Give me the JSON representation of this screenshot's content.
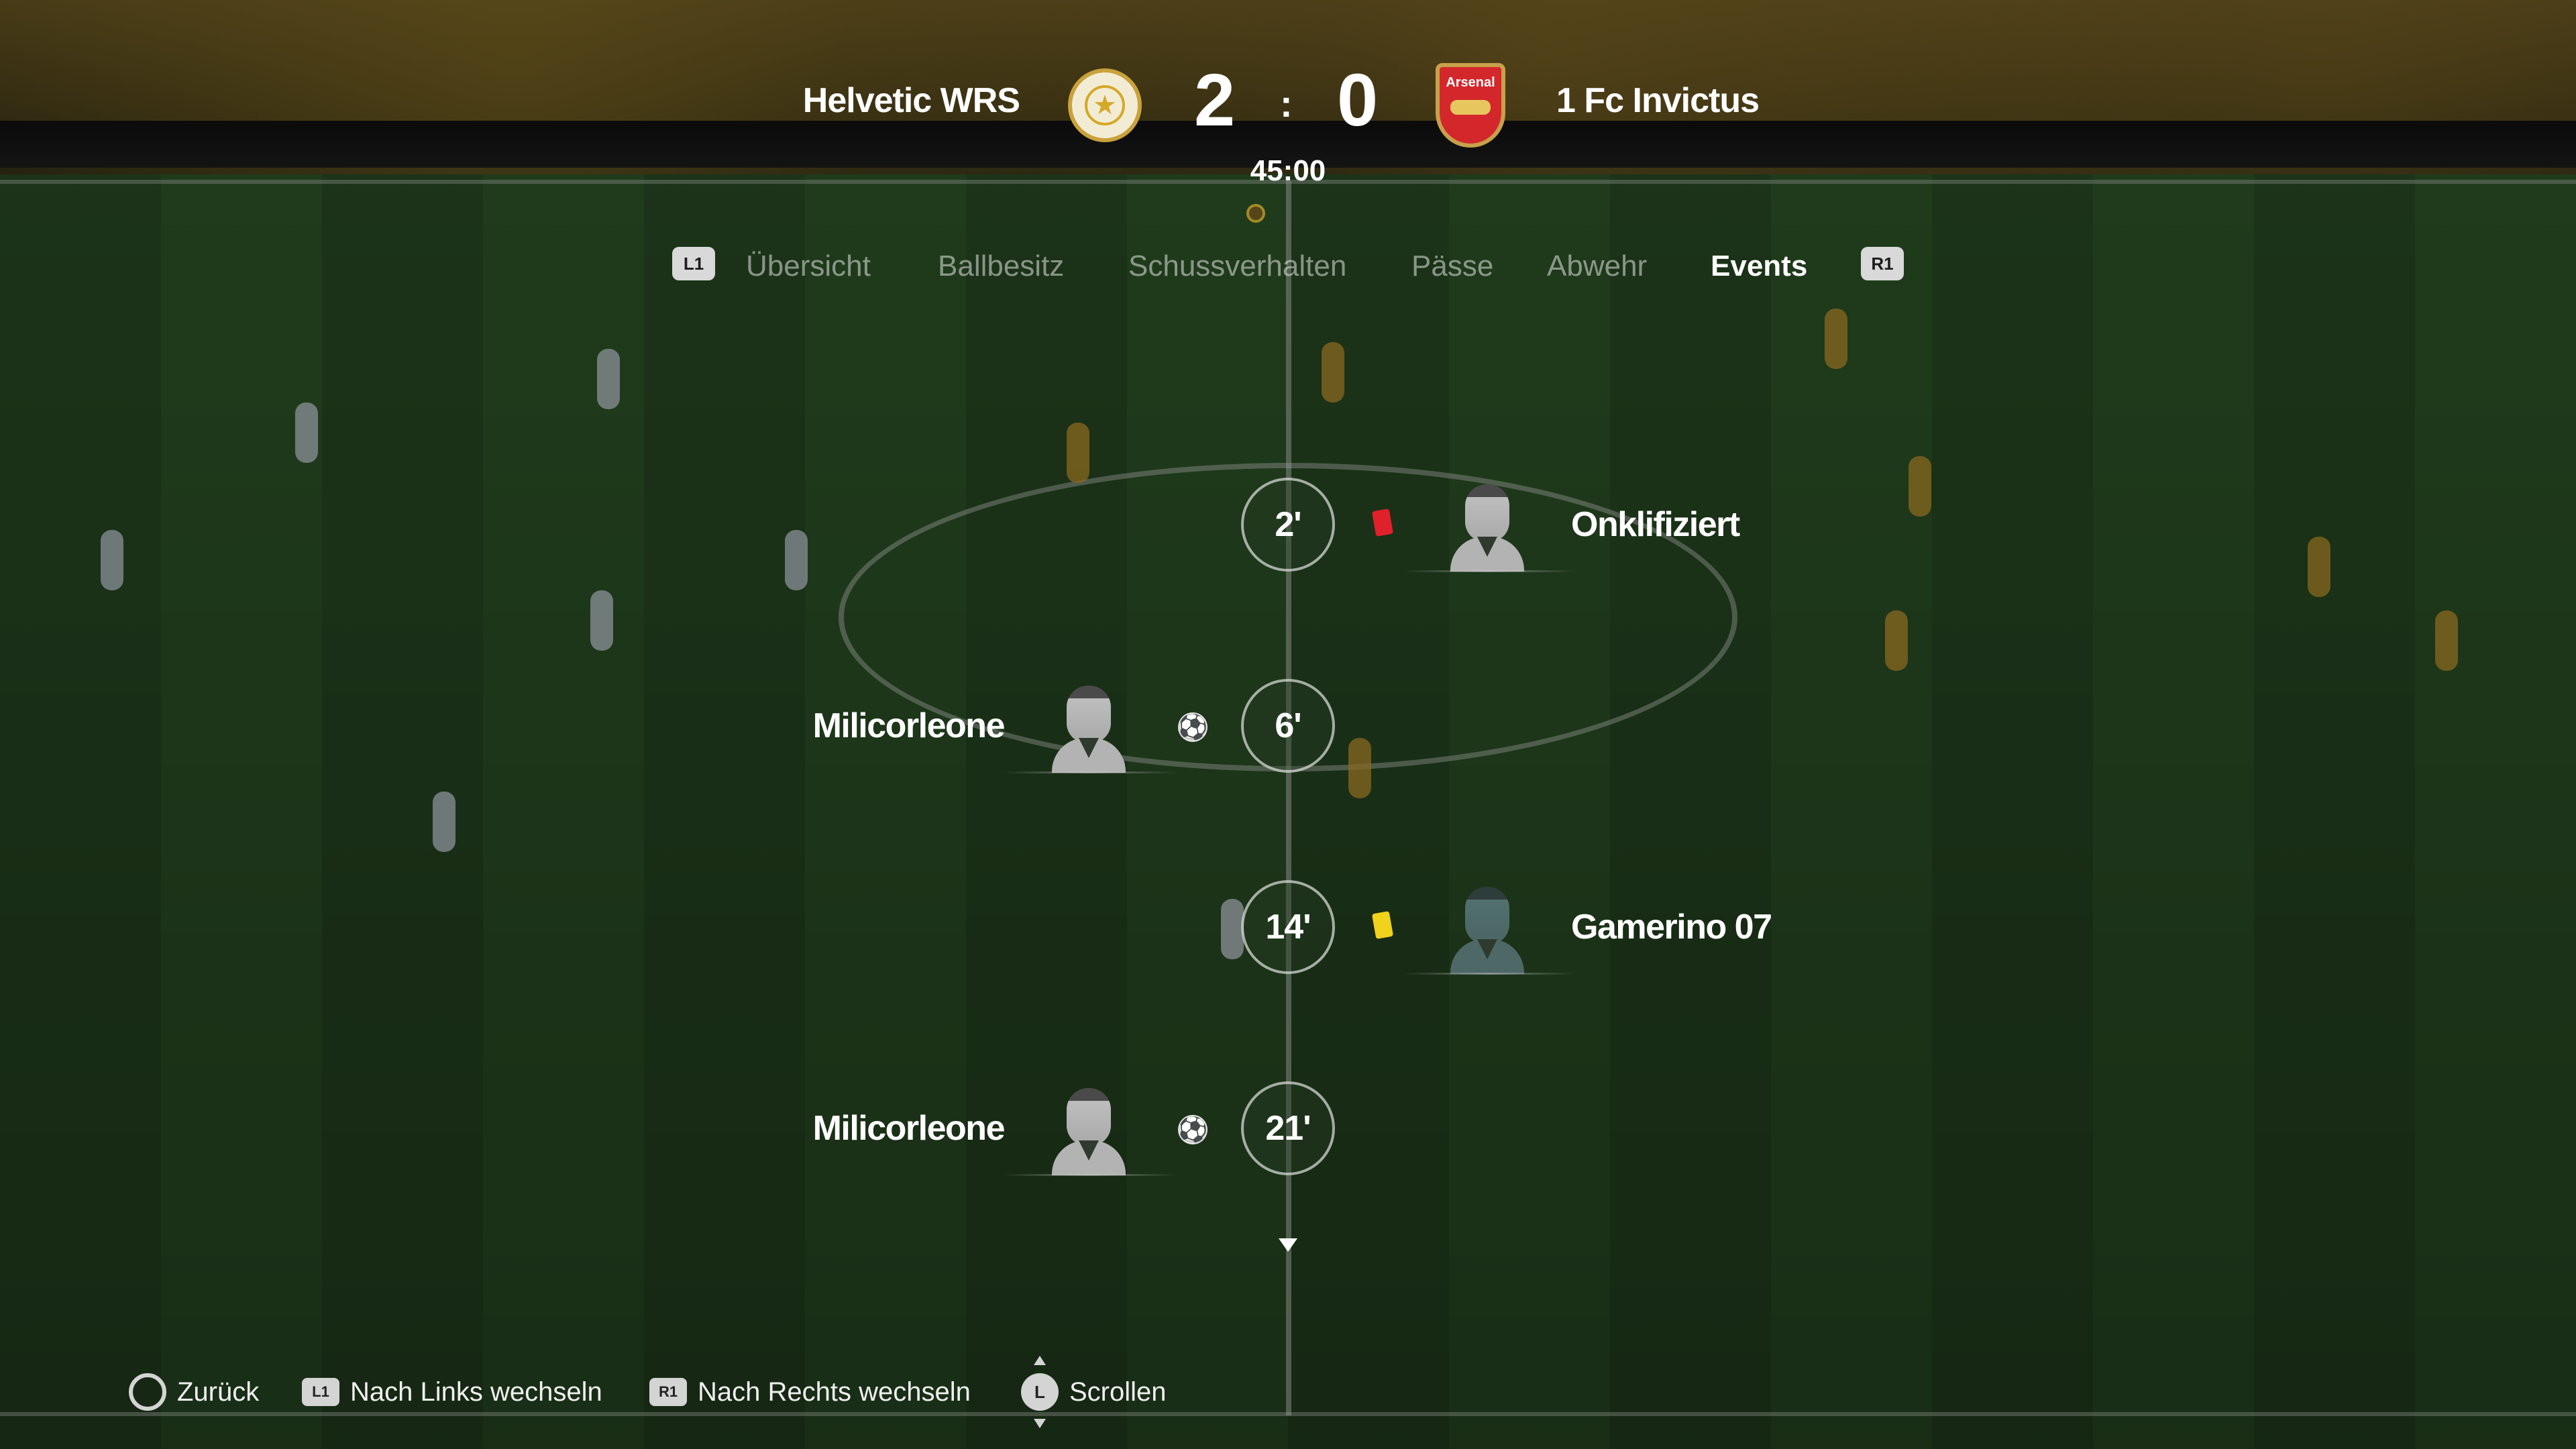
{
  "match": {
    "home_team": "Helvetic WRS",
    "away_team": "1 Fc Invictus",
    "home_score": "2",
    "away_score": "0",
    "score_separator": ":",
    "clock": "45:00",
    "away_crest_text": "Arsenal"
  },
  "tabs": {
    "left_button": "L1",
    "right_button": "R1",
    "items": [
      {
        "label": "Übersicht",
        "active": false
      },
      {
        "label": "Ballbesitz",
        "active": false
      },
      {
        "label": "Schussverhalten",
        "active": false
      },
      {
        "label": "Pässe",
        "active": false
      },
      {
        "label": "Abwehr",
        "active": false
      },
      {
        "label": "Events",
        "active": true
      }
    ]
  },
  "events": [
    {
      "minute": "2'",
      "side": "away",
      "type": "red-card",
      "player": "Onklifiziert"
    },
    {
      "minute": "6'",
      "side": "home",
      "type": "goal",
      "player": "Milicorleone"
    },
    {
      "minute": "14'",
      "side": "away",
      "type": "yellow-card",
      "player": "Gamerino 07"
    },
    {
      "minute": "21'",
      "side": "home",
      "type": "goal",
      "player": "Milicorleone"
    }
  ],
  "colors": {
    "red_card": "#e0202a",
    "yellow_card": "#f1d21c",
    "active_tab": "#ffffff",
    "inactive_tab": "#9aa39a"
  },
  "footer": {
    "back_label": "Zurück",
    "left_btn": "L1",
    "left_label": "Nach Links wechseln",
    "right_btn": "R1",
    "right_label": "Nach Rechts wechseln",
    "stick_btn": "L",
    "scroll_label": "Scrollen"
  }
}
